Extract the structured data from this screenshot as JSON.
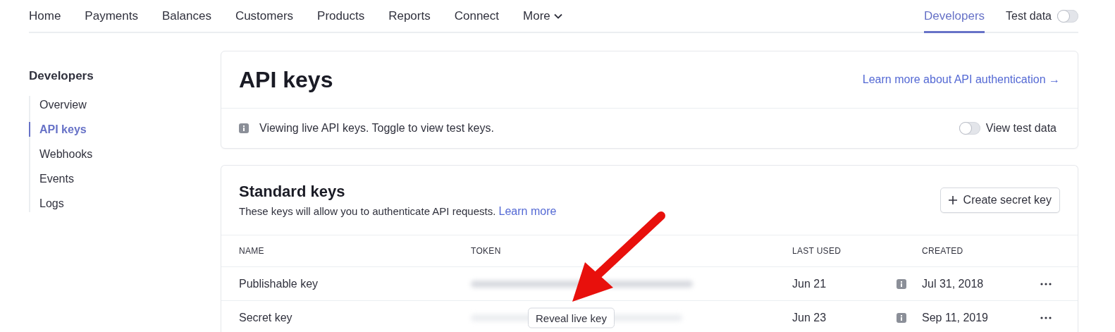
{
  "nav": {
    "items": [
      {
        "label": "Home",
        "selected": false
      },
      {
        "label": "Payments",
        "selected": false
      },
      {
        "label": "Balances",
        "selected": false
      },
      {
        "label": "Customers",
        "selected": false
      },
      {
        "label": "Products",
        "selected": false
      },
      {
        "label": "Reports",
        "selected": false
      },
      {
        "label": "Connect",
        "selected": false
      },
      {
        "label": "More",
        "selected": false,
        "kind": "dropdown"
      }
    ],
    "right_items": [
      {
        "label": "Developers",
        "selected": true
      }
    ],
    "test_data": {
      "label": "Test data",
      "on": false
    }
  },
  "sidebar": {
    "title": "Developers",
    "items": [
      {
        "label": "Overview",
        "selected": false
      },
      {
        "label": "API keys",
        "selected": true
      },
      {
        "label": "Webhooks",
        "selected": false
      },
      {
        "label": "Events",
        "selected": false
      },
      {
        "label": "Logs",
        "selected": false
      }
    ]
  },
  "header_card": {
    "title": "API keys",
    "link": "Learn more about API authentication →",
    "notice": "Viewing live API keys. Toggle to view test keys.",
    "view_test_data": {
      "label": "View test data",
      "on": false
    }
  },
  "keys_card": {
    "title": "Standard keys",
    "description": "These keys will allow you to authenticate API requests.",
    "description_link": "Learn more",
    "create_button": "Create secret key",
    "table": {
      "columns": [
        "NAME",
        "TOKEN",
        "LAST USED",
        "CREATED"
      ],
      "rows": [
        {
          "name": "Publishable key",
          "last_used": "Jun 21",
          "created": "Jul 31, 2018"
        },
        {
          "name": "Secret key",
          "reveal_button": "Reveal live key",
          "last_used": "Jun 23",
          "created": "Sep 11, 2019"
        }
      ]
    }
  }
}
